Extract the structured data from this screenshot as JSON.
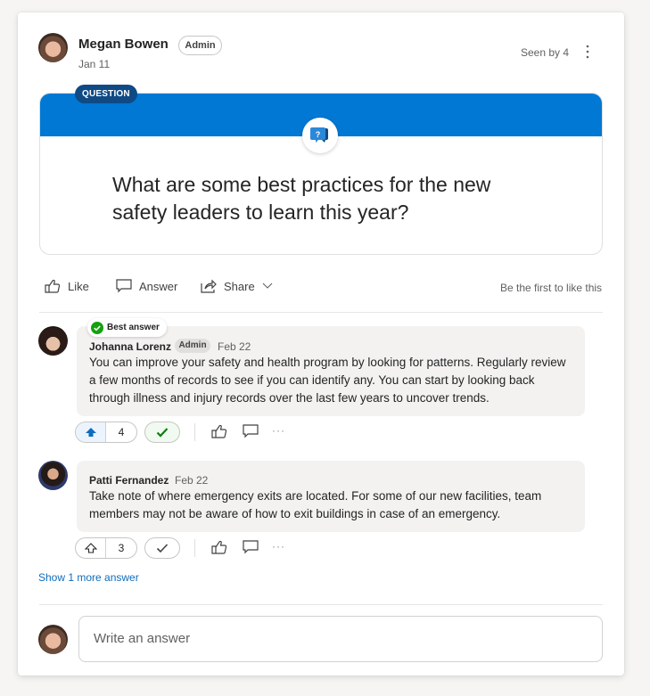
{
  "post": {
    "author": "Megan Bowen",
    "role_badge": "Admin",
    "date": "Jan 11",
    "seen_by": "Seen by 4",
    "more_icon": "more-vertical-icon",
    "type_label": "QUESTION",
    "question": "What are some best practices for the new safety leaders to learn this year?"
  },
  "actions": {
    "like": "Like",
    "answer": "Answer",
    "share": "Share",
    "like_status": "Be the first to like this"
  },
  "answers": [
    {
      "best_label": "Best answer",
      "author": "Johanna Lorenz",
      "role_badge": "Admin",
      "date": "Feb 22",
      "text": "You can improve your safety and health program by looking for patterns. Regularly review a few months of records to see if you can identify any. You can start by looking back through illness and injury records over the last few years to uncover trends.",
      "upvotes": "4",
      "upvoted": true,
      "marked_best": true
    },
    {
      "author": "Patti Fernandez",
      "date": "Feb 22",
      "text": "Take note of where emergency exits are located. For some of our new facilities, team members may not be aware of how to exit buildings in case of an emergency.",
      "upvotes": "3",
      "upvoted": false,
      "marked_best": false
    }
  ],
  "show_more": "Show 1 more answer",
  "composer": {
    "placeholder": "Write an answer"
  },
  "colors": {
    "accent": "#0078d4",
    "label_bg": "#0f4a85",
    "best_green": "#13a10e",
    "link": "#0f6cbd"
  }
}
